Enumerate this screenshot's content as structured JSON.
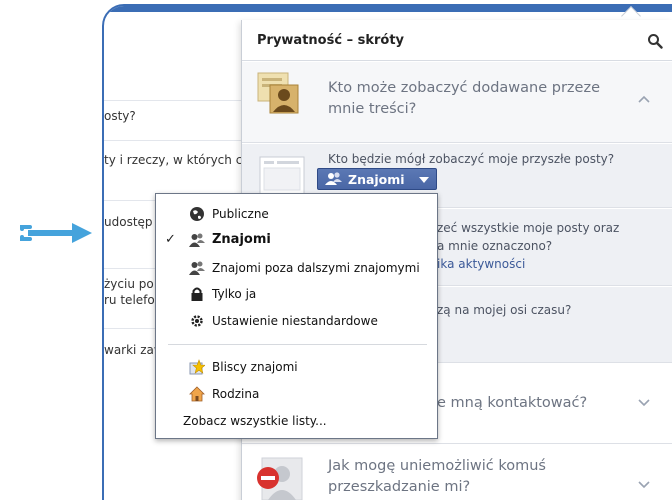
{
  "background_page": {
    "rows": [
      {
        "text": "osty?"
      },
      {
        "text": "ty i rzeczy, w których c"
      },
      {
        "text": " udostęp"
      },
      {
        "text": "życiu po"
      },
      {
        "text": "ru telefo"
      },
      {
        "text": "warki zaw"
      }
    ]
  },
  "panel": {
    "title": "Prywatność – skróty",
    "section1": {
      "title_line1": "Kto może zobaczyć dodawane przeze",
      "title_line2": "mnie treści?",
      "sub1": "Kto będzie mógł zobaczyć moje przyszłe posty?",
      "audience_label": "Znajomi",
      "sub2_line1": "zeć wszystkie moje posty oraz",
      "sub2_line2": "a mnie oznaczono?",
      "sub2_link": "ika aktywności",
      "sub3": "zą na mojej osi czasu?"
    },
    "section2": {
      "title": "e mną kontaktować?"
    },
    "section3": {
      "title_line1": "Jak mogę uniemożliwić komuś",
      "title_line2": "przeszkadzanie mi?"
    }
  },
  "menu": {
    "items": [
      {
        "label": "Publiczne",
        "icon": "globe-icon",
        "checked": false
      },
      {
        "label": "Znajomi",
        "icon": "friends-icon",
        "checked": true
      },
      {
        "label": "Znajomi poza dalszymi znajomymi",
        "icon": "friends-icon",
        "checked": false
      },
      {
        "label": "Tylko ja",
        "icon": "lock-icon",
        "checked": false
      },
      {
        "label": "Ustawienie niestandardowe",
        "icon": "gear-icon",
        "checked": false
      }
    ],
    "lists": [
      {
        "label": "Bliscy znajomi",
        "icon": "star-icon"
      },
      {
        "label": "Rodzina",
        "icon": "house-icon"
      }
    ],
    "see_all": "Zobacz wszystkie listy..."
  },
  "colors": {
    "frame_blue": "#3b6db5",
    "arrow_blue": "#45a3dc",
    "button_blue": "#4a67a6",
    "link_blue": "#3b5998",
    "block_red": "#d8322e"
  }
}
